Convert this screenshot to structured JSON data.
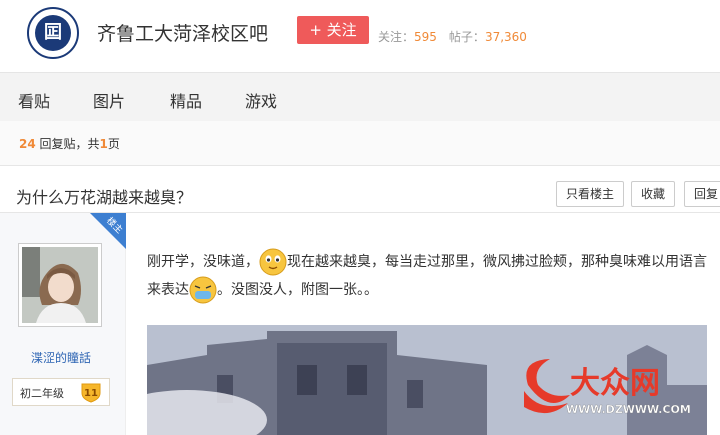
{
  "header": {
    "bar_name": "齐鲁工大菏泽校区吧",
    "follow_label": "+ 关注",
    "follow_count_label": "关注：",
    "follow_count": "595",
    "post_count_label": "帖子：",
    "post_count": "37,360",
    "logo_char": "囸"
  },
  "nav": {
    "items": [
      "看贴",
      "图片",
      "精品",
      "游戏"
    ]
  },
  "pager": {
    "reply_count": "24",
    "reply_text": "回复贴，共",
    "page_count": "1",
    "page_text": "页"
  },
  "thread": {
    "title": "为什么万花湖越来越臭？",
    "buttons": {
      "only_op": "只看楼主",
      "favorite": "收藏",
      "reply": "回复"
    }
  },
  "post": {
    "op_badge": "楼主",
    "username": "渫涩的瞳話",
    "level_name": "初二年级",
    "level_num": "11",
    "text_part1": "刚开学，没味道，",
    "text_part2": "现在越来越臭，每当走过那里，微风拂过脸颊，那种臭味难以用语言来表达",
    "text_part3": "。没图没人，附图一张。。",
    "watermark_brand": "大众网",
    "watermark_url": "WWW.DZWWW.COM"
  },
  "colors": {
    "follow_btn": "#ef5a5a",
    "count_orange": "#f08a38",
    "link_blue": "#2d64b3",
    "badge_blue": "#3d7fd1"
  }
}
